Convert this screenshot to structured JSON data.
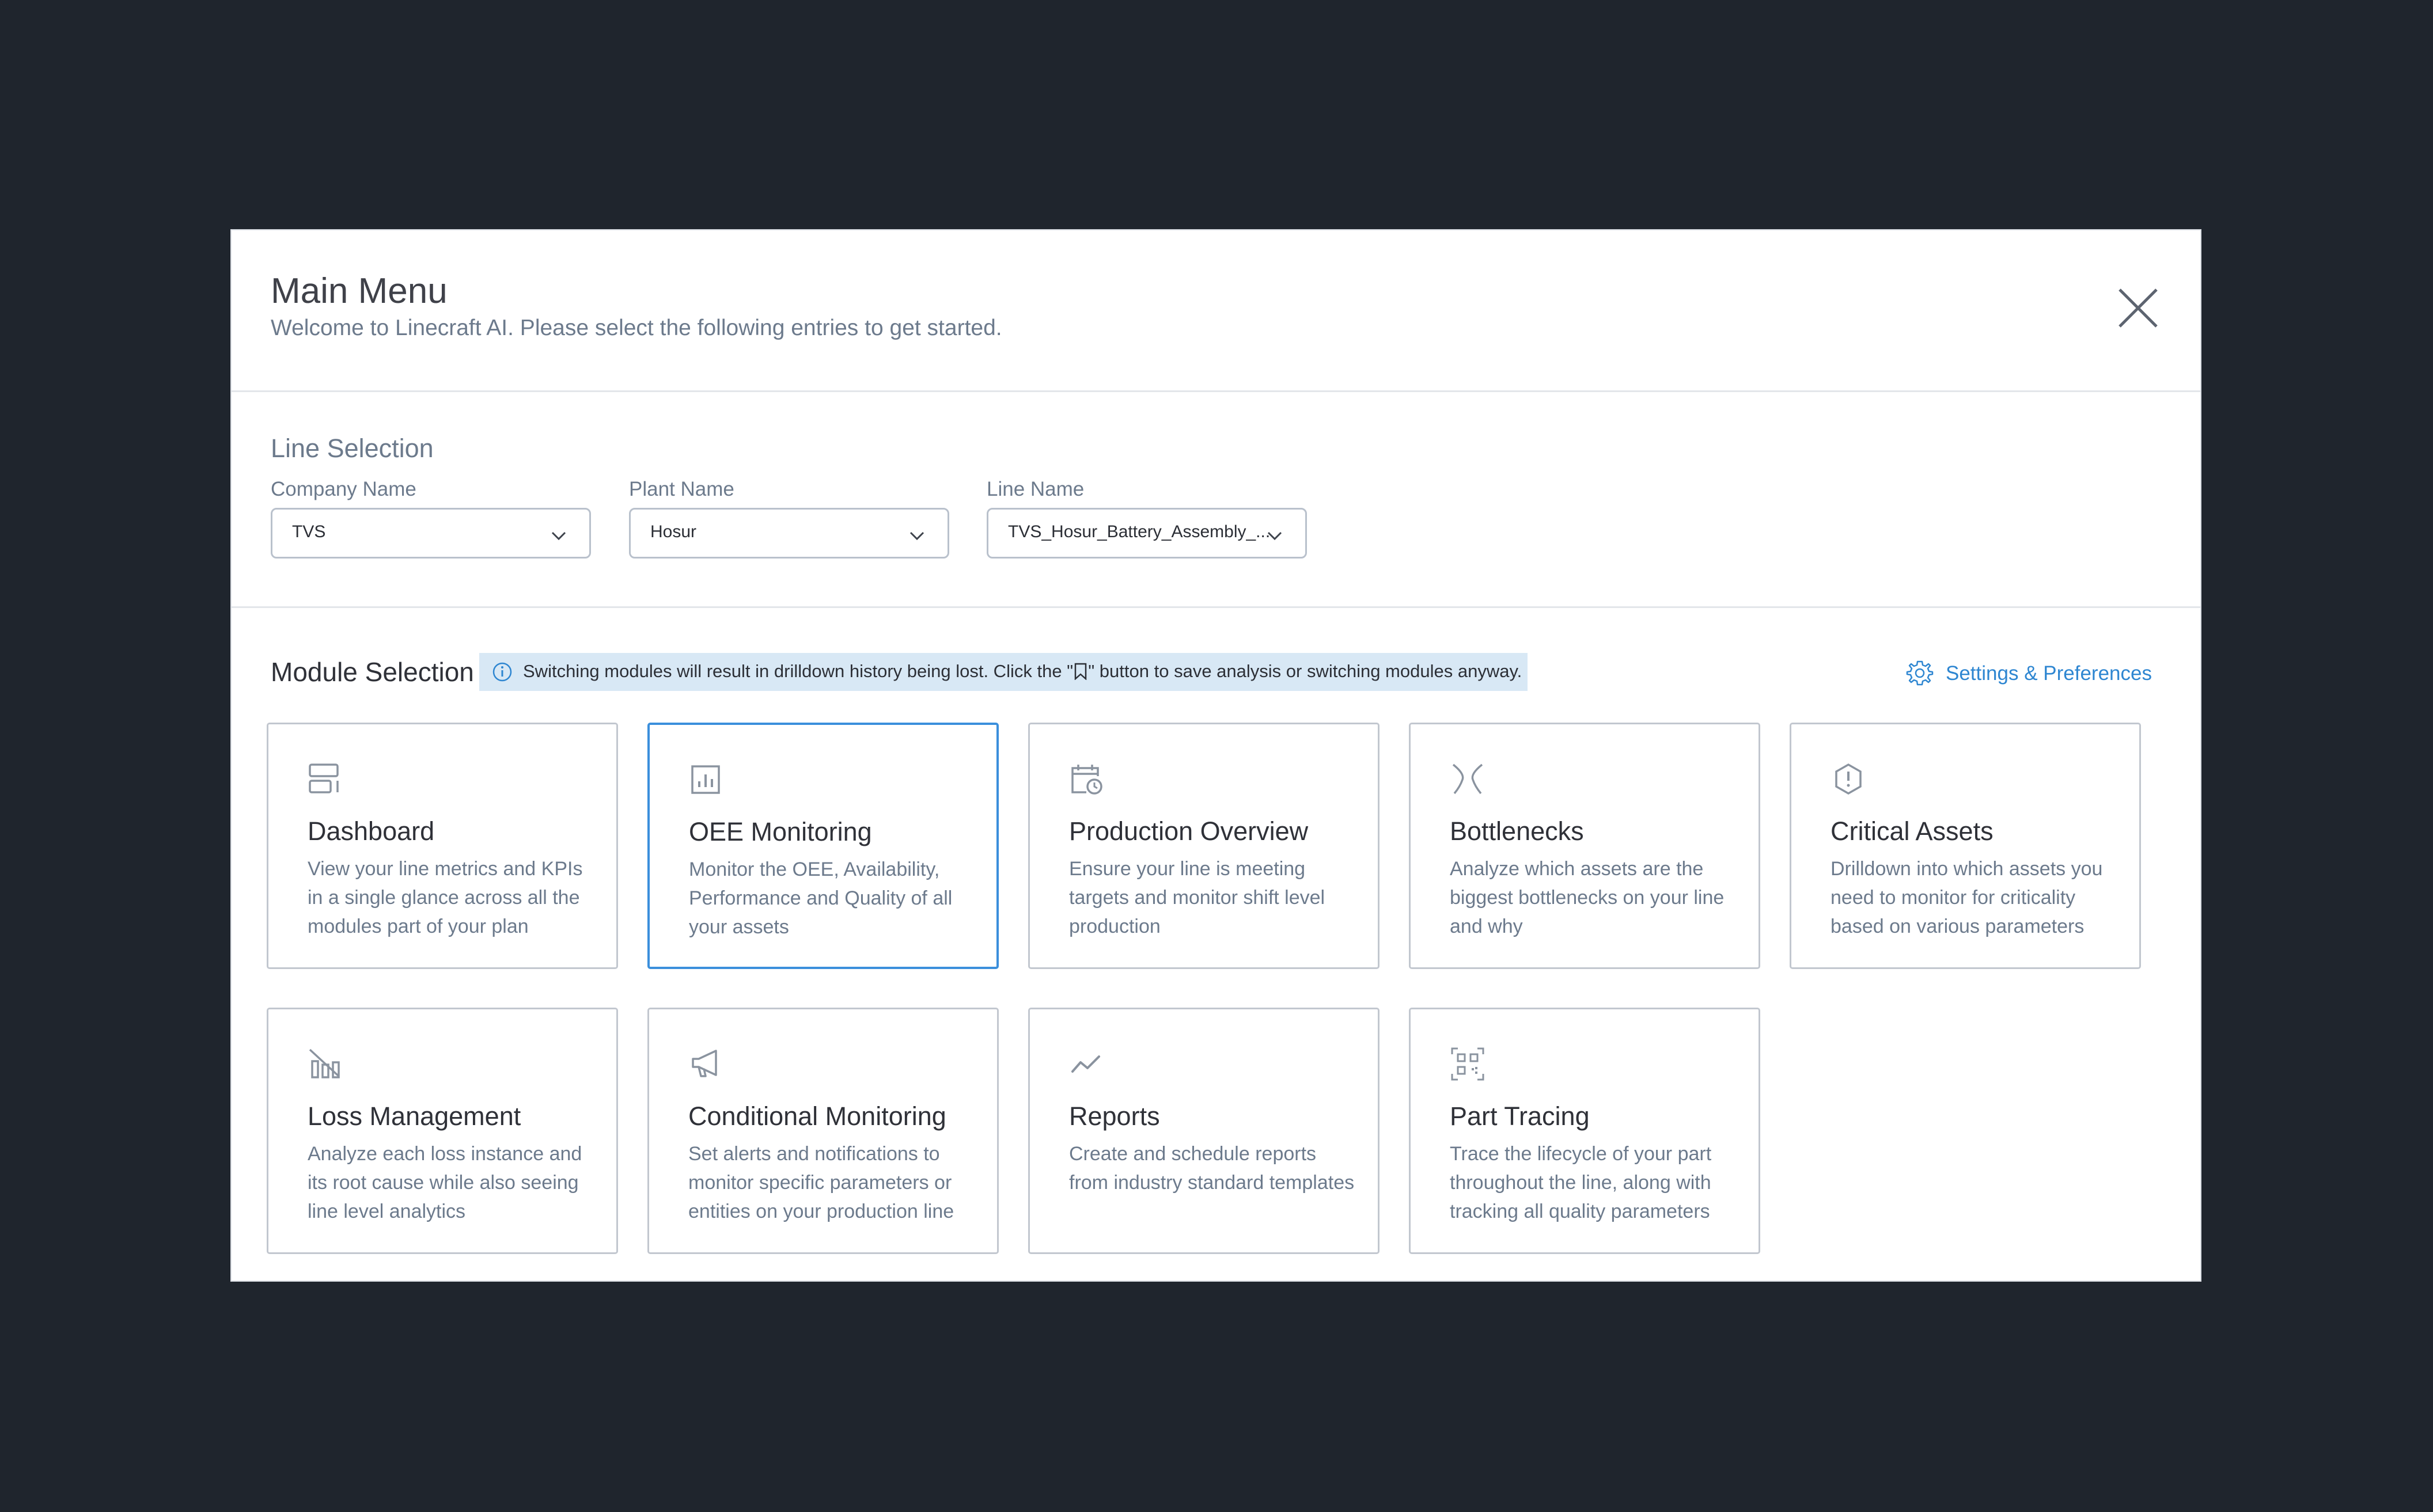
{
  "header": {
    "title": "Main Menu",
    "subtitle": "Welcome to Linecraft AI. Please select the following entries to get started."
  },
  "line_selection": {
    "title": "Line Selection",
    "company": {
      "label": "Company Name",
      "value": "TVS"
    },
    "plant": {
      "label": "Plant Name",
      "value": "Hosur"
    },
    "line": {
      "label": "Line Name",
      "value": "TVS_Hosur_Battery_Assembly_..."
    }
  },
  "module_selection": {
    "title": "Module Selection",
    "notice_before": "Switching modules will result in drilldown history being lost. Click the \"",
    "notice_after": "\" button to save analysis or switching modules anyway.",
    "settings_label": "Settings & Preferences",
    "selected_module": "OEE Monitoring"
  },
  "modules": [
    {
      "title": "Dashboard",
      "desc": "View your line metrics and KPIs in a single glance across all the modules part of your plan",
      "icon": "dashboard-icon"
    },
    {
      "title": "OEE Monitoring",
      "desc": "Monitor the OEE, Availability, Performance and Quality of all your assets",
      "icon": "bar-chart-icon"
    },
    {
      "title": "Production Overview",
      "desc": "Ensure your line is meeting targets and monitor shift level production",
      "icon": "calendar-clock-icon"
    },
    {
      "title": "Bottlenecks",
      "desc": "Analyze which assets are the biggest bottlenecks on your line and why",
      "icon": "bottleneck-icon"
    },
    {
      "title": "Critical Assets",
      "desc": "Drilldown into which assets you need to monitor for criticality based on various parameters",
      "icon": "alert-shield-icon"
    },
    {
      "title": "Loss Management",
      "desc": "Analyze each loss instance and its root cause while also seeing line level analytics",
      "icon": "loss-chart-icon"
    },
    {
      "title": "Conditional Monitoring",
      "desc": "Set alerts and notifications to monitor specific parameters or entities on your production line",
      "icon": "megaphone-icon"
    },
    {
      "title": "Reports",
      "desc": "Create and schedule reports from industry standard templates",
      "icon": "trend-icon"
    },
    {
      "title": "Part Tracing",
      "desc": "Trace the lifecycle of your part throughout the line, along with tracking all quality parameters",
      "icon": "qr-scan-icon"
    }
  ],
  "colors": {
    "backdrop": "#1f252d",
    "accent": "#3b8fdc",
    "link": "#2e86d1",
    "notice_bg": "#d8e8f5"
  }
}
